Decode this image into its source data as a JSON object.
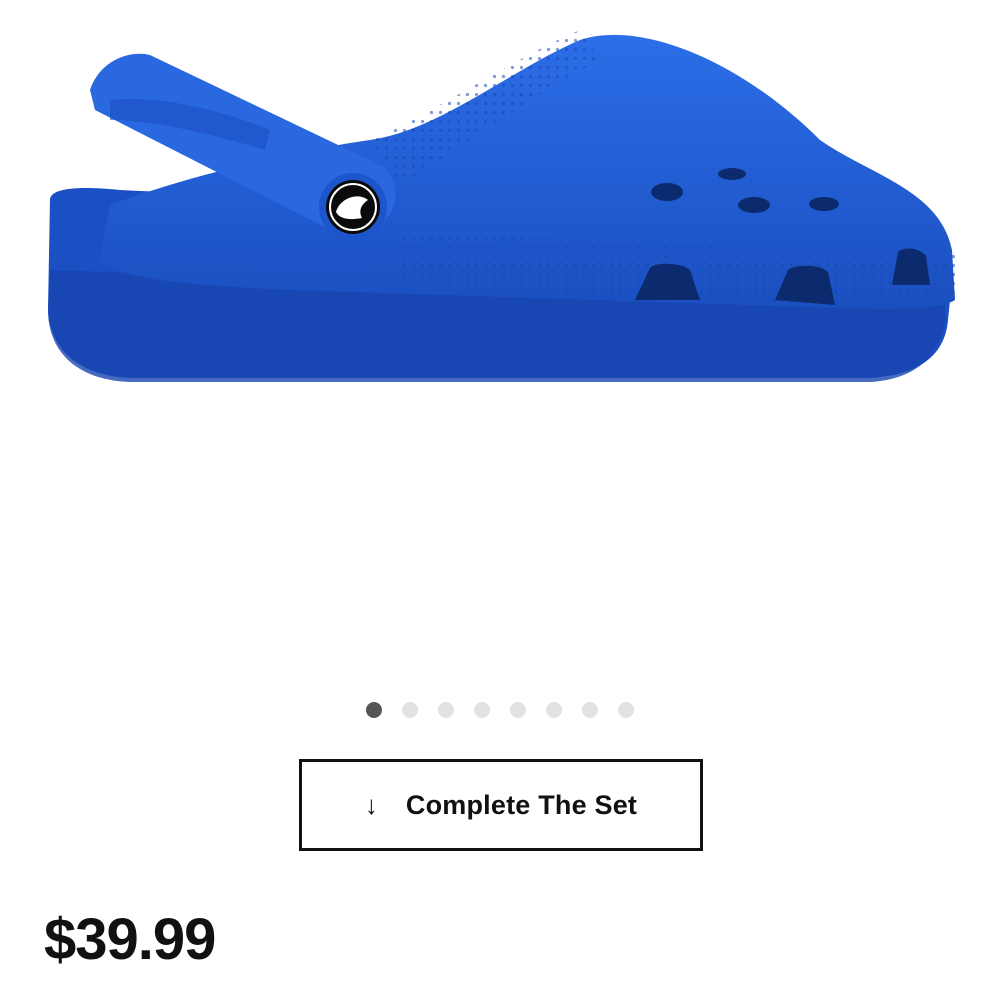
{
  "product": {
    "image_alt": "Blue Crocs classic clog",
    "color": "#1f5fd6",
    "logo_icon": "crocs-jibbitz-logo"
  },
  "carousel": {
    "total": 8,
    "active_index": 0
  },
  "cta": {
    "icon": "arrow-down-icon",
    "icon_glyph": "↓",
    "label": "Complete The Set"
  },
  "price": "$39.99"
}
